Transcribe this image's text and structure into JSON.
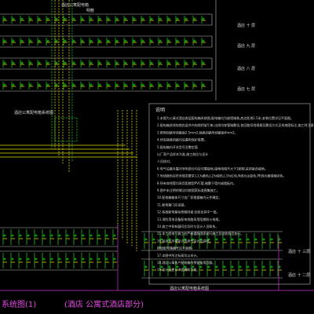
{
  "title_bottom_left": "系统图(1)",
  "title_bottom_center": "(酒店 公寓式酒店部分)",
  "labels": {
    "top_riser": "酒店公寓配电箱",
    "top_small": "明敷",
    "left_mid": "酒店公寓配电箱系统图",
    "bottom_center": "酒店公寓配电箱系统图",
    "row_right_1": "酒店 十 层",
    "row_right_2": "酒店 九 层",
    "row_right_3": "酒店 八 层",
    "row_right_4": "酒店 七 层",
    "bottom_right_1": "酒店 十 三层",
    "bottom_right_2": "酒店 十 二层"
  },
  "notes": {
    "heading": "说明",
    "lines": [
      "1.本图为公寓式酒店各层配电箱系统图,配电箱均为嵌墙暗装,底边距地1.5米,安装位置详见平面图。",
      "2.配电箱进线电缆由竖井内电缆桥架引来,出线均穿管暗敷设,各回路导线规格及敷设方式见系统图标注,施工时注意与其它专业配合。",
      "3.照明回路导线截面2.5mm2,插座回路导线截面4mm2。",
      "4.所有插座回路均设漏电保护装置。",
      "5.配电箱内开关型号及整定值",
      "  以厂家产品样本为准,施工前应与设计",
      "  人员核对。",
      "6.电气设备外露可导电部分均应可靠接地,接地电阻不大于1欧姆,采用联合接地。",
      "7.导线颜色应符合规范要求,L1为黄色,L2为绿色,L3为红色,N线为淡蓝色,PE线为黄绿相间色。",
      "8.所有穿线管均采用阻燃型PVC管,暗敷于墙内或楼板内。",
      "9.图中未注明的做法均按国家标准图集施工。",
      "10.配电箱箱体尺寸由厂家根据箱内元件确定。",
      "11.配电箱门应设锁。",
      "12.各层配电箱系统相同者,仅绘出其中一层。",
      "13.消防用电设备配电线路采用阻燃耐火电缆。",
      "14.施工中如有疑问应及时与设计人员联系。",
      "15.本工程电气施工应严格遵照国家现行施工及验收规范执行。",
      "16.其余未尽事宜详见电气设计总说明。",
      "  楼层配电箱编号见平面图。",
      "17.本图中所注标高均以米计。",
      "18.酒店公寓各户配电箱内预留备用回路。",
      "19.设计变更以书面通知为准。"
    ]
  },
  "colors": {
    "background": "#000000",
    "green": "#19c219",
    "yellow": "#d8d800",
    "magenta": "#e34be3",
    "white": "#d8d8d8"
  }
}
